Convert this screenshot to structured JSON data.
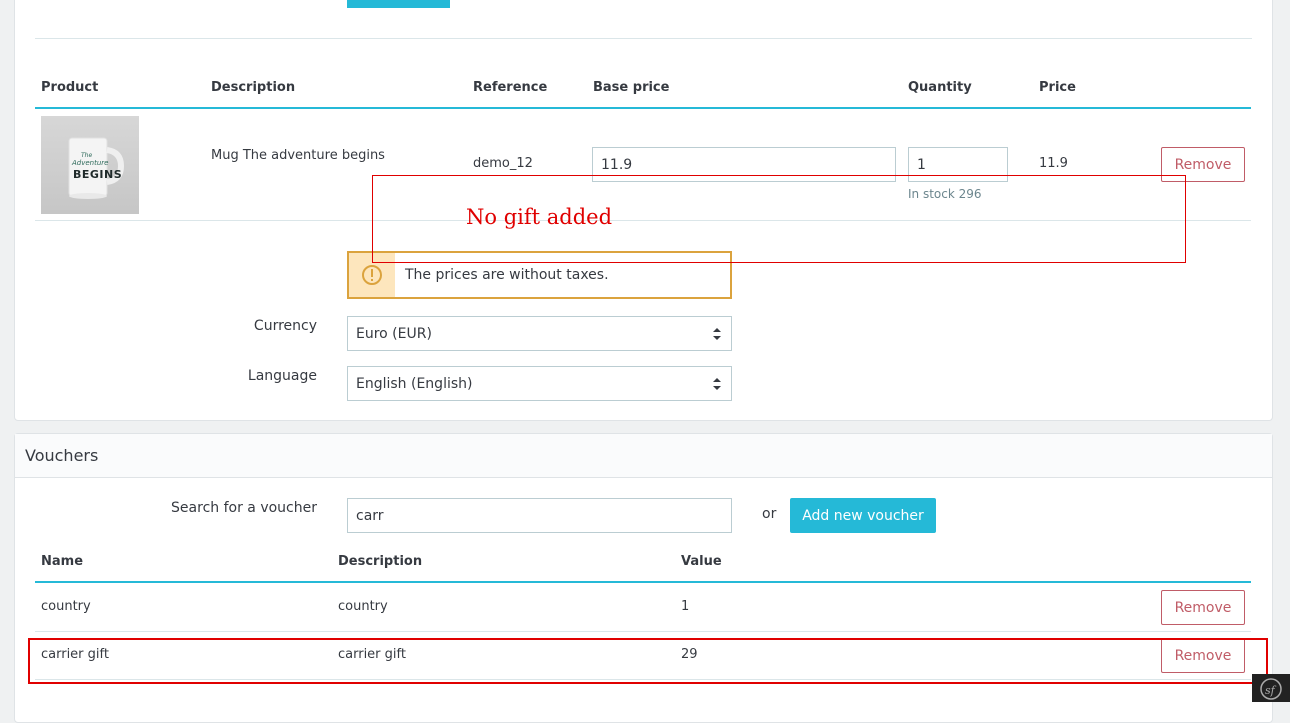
{
  "products_table": {
    "headers": {
      "product": "Product",
      "description": "Description",
      "reference": "Reference",
      "base_price": "Base price",
      "quantity": "Quantity",
      "price": "Price"
    },
    "row": {
      "description": "Mug The adventure begins",
      "reference": "demo_12",
      "base_price": "11.9",
      "quantity": "1",
      "stock": "In stock 296",
      "price": "11.9",
      "remove_label": "Remove"
    },
    "mug_image": {
      "line1": "The",
      "line2": "Adventure",
      "line3": "BEGINS"
    }
  },
  "annotation": {
    "text": "No gift added"
  },
  "alert": {
    "text": "The prices are without taxes."
  },
  "currency": {
    "label": "Currency",
    "selected": "Euro (EUR)"
  },
  "language": {
    "label": "Language",
    "selected": "English (English)"
  },
  "vouchers": {
    "title": "Vouchers",
    "search_label": "Search for a voucher",
    "search_value": "carr",
    "or_text": "or",
    "add_button": "Add new voucher",
    "headers": {
      "name": "Name",
      "description": "Description",
      "value": "Value"
    },
    "rows": [
      {
        "name": "country",
        "description": "country",
        "value": "1",
        "remove_label": "Remove"
      },
      {
        "name": "carrier gift",
        "description": "carrier gift",
        "value": "29",
        "remove_label": "Remove"
      }
    ]
  },
  "colors": {
    "accent": "#25b9d7",
    "danger": "#c05c67",
    "warning": "#dba33d",
    "annotation": "#e00000"
  },
  "icons": [
    "warning-icon",
    "select-arrows-icon",
    "symfony-icon"
  ]
}
